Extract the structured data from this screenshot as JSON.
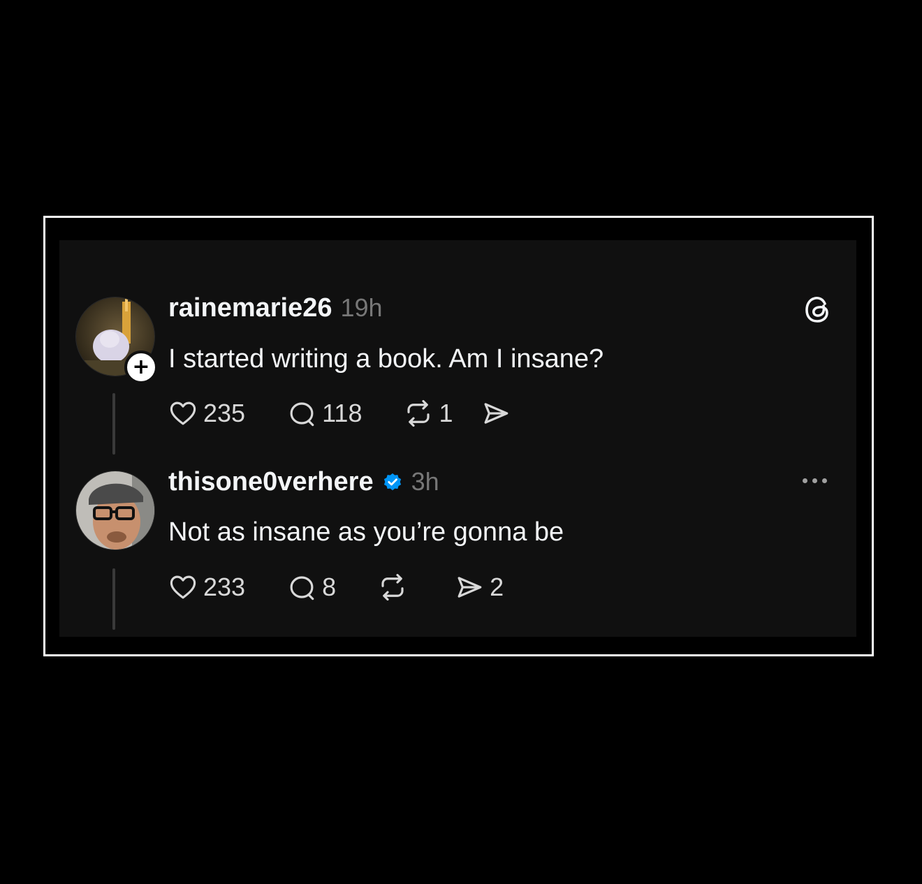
{
  "posts": [
    {
      "username": "rainemarie26",
      "time": "19h",
      "text": "I started writing a book. Am I insane?",
      "likes": "235",
      "replies": "118",
      "reposts": "1",
      "shares": ""
    },
    {
      "username": "thisone0verhere",
      "time": "3h",
      "text": "Not as insane as you’re gonna be",
      "likes": "233",
      "replies": "8",
      "reposts": "",
      "shares": "2"
    }
  ],
  "follow_badge": "+",
  "colors": {
    "background": "#000000",
    "card": "#101010",
    "text": "#f3f5f7",
    "muted": "#777777",
    "verified": "#0095f6"
  },
  "icons": {
    "logo": "threads-logo-icon",
    "like": "heart-icon",
    "reply": "comment-icon",
    "repost": "repost-icon",
    "share": "send-icon",
    "more": "more-icon",
    "verified": "verified-badge-icon"
  }
}
